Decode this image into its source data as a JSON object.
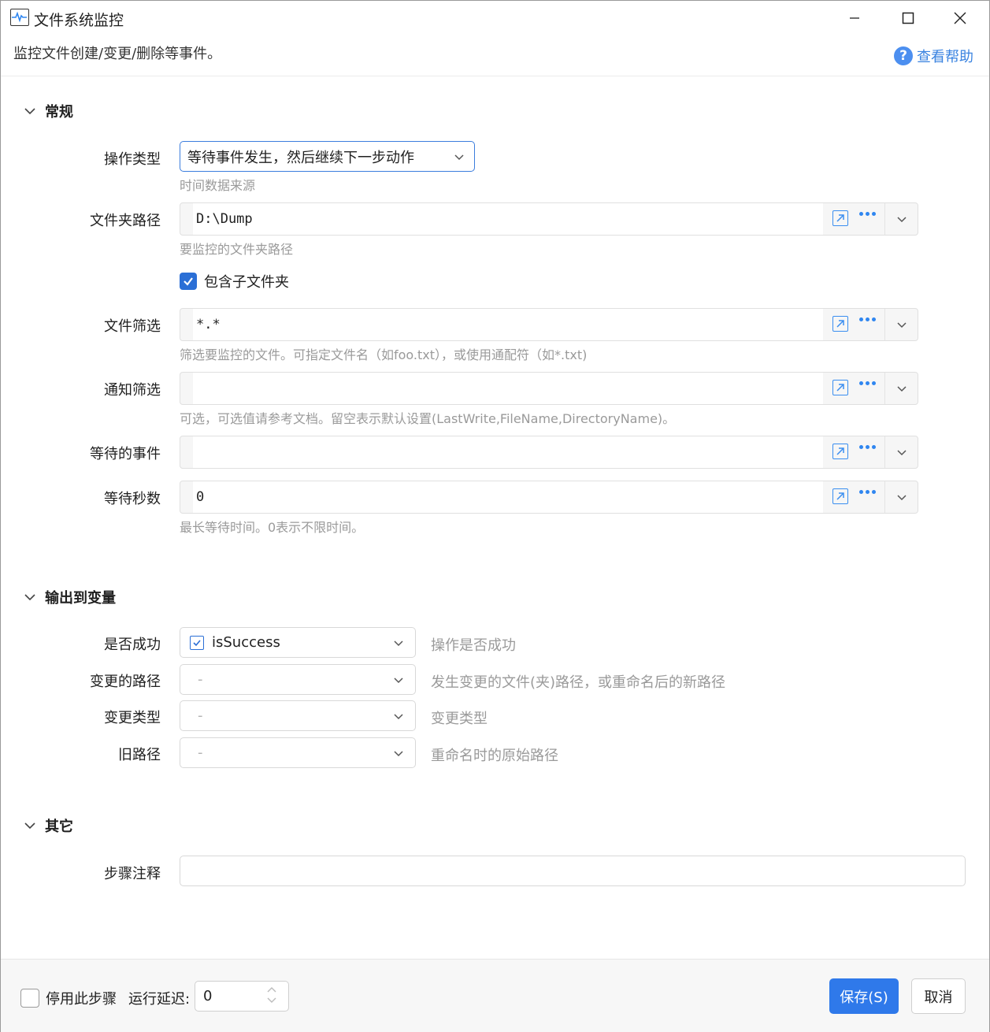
{
  "window": {
    "title": "文件系统监控",
    "subtitle": "监控文件创建/变更/删除等事件。",
    "help_label": "查看帮助",
    "icon": "activity-monitor-icon"
  },
  "sections": {
    "general": {
      "title": "常规"
    },
    "output": {
      "title": "输出到变量"
    },
    "other": {
      "title": "其它"
    }
  },
  "general": {
    "operation_type": {
      "label": "操作类型",
      "value": "等待事件发生，然后继续下一步动作",
      "hint": "时间数据来源"
    },
    "folder_path": {
      "label": "文件夹路径",
      "value": "D:\\Dump",
      "hint": "要监控的文件夹路径"
    },
    "include_subfolders": {
      "label": "包含子文件夹",
      "checked": true
    },
    "file_filter": {
      "label": "文件筛选",
      "value": "*.*",
      "hint": "筛选要监控的文件。可指定文件名（如foo.txt），或使用通配符（如*.txt)"
    },
    "notify_filter": {
      "label": "通知筛选",
      "value": "",
      "hint": "可选，可选值请参考文档。留空表示默认设置(LastWrite,FileName,DirectoryName)。"
    },
    "wait_events": {
      "label": "等待的事件",
      "value": ""
    },
    "wait_seconds": {
      "label": "等待秒数",
      "value": "0",
      "hint": "最长等待时间。0表示不限时间。"
    }
  },
  "output": {
    "rows": [
      {
        "label": "是否成功",
        "value": "isSuccess",
        "description": "操作是否成功"
      },
      {
        "label": "变更的路径",
        "value": "-",
        "description": "发生变更的文件(夹)路径，或重命名后的新路径"
      },
      {
        "label": "变更类型",
        "value": "-",
        "description": "变更类型"
      },
      {
        "label": "旧路径",
        "value": "-",
        "description": "重命名时的原始路径"
      }
    ]
  },
  "other": {
    "comment": {
      "label": "步骤注释",
      "value": ""
    }
  },
  "footer": {
    "disable_label": "停用此步骤",
    "delay_label": "运行延迟:",
    "delay_value": "0",
    "save_label": "保存(S)",
    "cancel_label": "取消"
  },
  "colors": {
    "accent": "#2f79ea",
    "link": "#3a83e0",
    "hint": "#9a9a9a"
  }
}
